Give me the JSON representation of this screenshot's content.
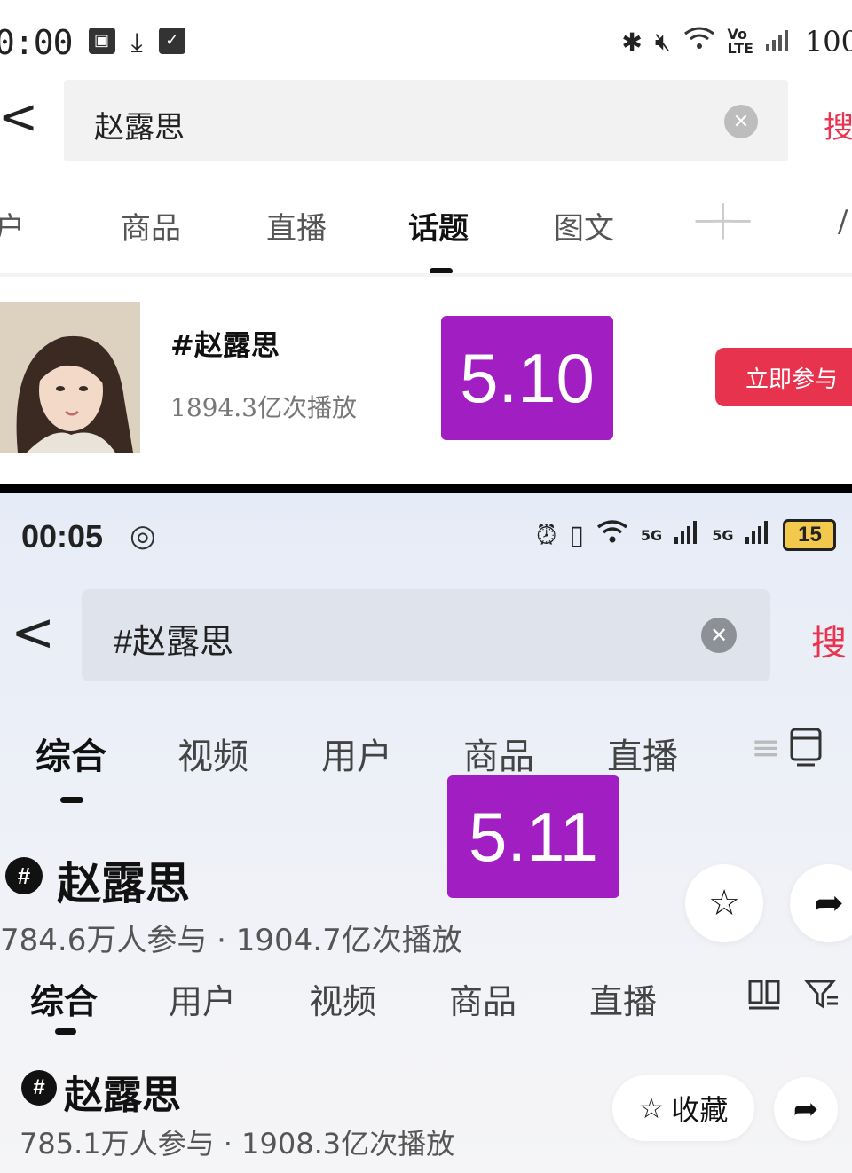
{
  "top": {
    "status": {
      "time": "0:00",
      "battery": "100"
    },
    "search": {
      "query": "赵露思",
      "button": "搜"
    },
    "tabs": [
      {
        "label": "户",
        "active": false
      },
      {
        "label": "商品",
        "active": false
      },
      {
        "label": "直播",
        "active": false
      },
      {
        "label": "话题",
        "active": true
      },
      {
        "label": "图文",
        "active": false
      }
    ],
    "topic": {
      "title": "#赵露思",
      "plays": "1894.3亿次播放",
      "join_label": "立即参与"
    },
    "date_badge": "5.10"
  },
  "bottom": {
    "status": {
      "time": "00:05",
      "net1": "5G",
      "net2": "5G",
      "battery": "15"
    },
    "search": {
      "query": "#赵露思",
      "button": "搜"
    },
    "tabs1": [
      {
        "label": "综合",
        "active": true
      },
      {
        "label": "视频",
        "active": false
      },
      {
        "label": "用户",
        "active": false
      },
      {
        "label": "商品",
        "active": false
      },
      {
        "label": "直播",
        "active": false
      }
    ],
    "topic1": {
      "title": "赵露思",
      "stats": "784.6万人参与 · 1904.7亿次播放"
    },
    "date_badge": "5.11",
    "tabs2": [
      {
        "label": "综合",
        "active": true
      },
      {
        "label": "用户",
        "active": false
      },
      {
        "label": "视频",
        "active": false
      },
      {
        "label": "商品",
        "active": false
      },
      {
        "label": "直播",
        "active": false
      }
    ],
    "topic2": {
      "title": "赵露思",
      "stats": "785.1万人参与 · 1908.3亿次播放",
      "fav_label": "收藏"
    }
  },
  "colors": {
    "accent_red": "#e8344f",
    "badge_purple": "#a11ec3"
  }
}
